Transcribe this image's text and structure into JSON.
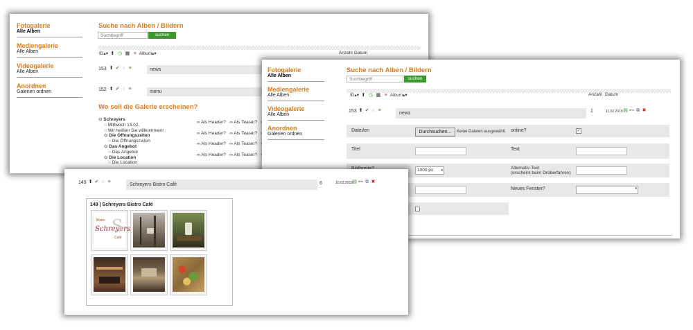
{
  "sidebar_top": {
    "items": [
      {
        "head": "Fotogalerie",
        "sub": "Alle Alben"
      },
      {
        "head": "Mediengalerie",
        "sub": "Alle Alben"
      },
      {
        "head": "Videogalerie",
        "sub": "Alle Alben"
      },
      {
        "head": "Anordnen",
        "sub": "Galerien ordnen"
      }
    ]
  },
  "sidebar_right": {
    "items": [
      {
        "head": "Fotogalerie",
        "sub": "Alle Alben"
      },
      {
        "head": "Mediengalerie",
        "sub": "Alle Alben"
      },
      {
        "head": "Videogalerie",
        "sub": "Alle Alben"
      },
      {
        "head": "Anordnen",
        "sub": "Galerien ordnen"
      }
    ]
  },
  "search": {
    "title": "Suche nach Alben / Bildern",
    "placeholder": "Suchbegriff",
    "button": "suchen"
  },
  "table": {
    "col_id": "ID",
    "col_album": "Album",
    "col_count": "Anzahl",
    "col_date": "Datum"
  },
  "back_rows": [
    {
      "id": "153",
      "name": "news"
    },
    {
      "id": "152",
      "name": "menu"
    }
  ],
  "placement": {
    "title": "Wo soll die Galerie erscheinen?",
    "tree": [
      {
        "label": "Schreyers",
        "bold": true,
        "level": 0
      },
      {
        "label": "Mittwoch 13.02.",
        "bold": false,
        "level": 1
      },
      {
        "label": "Wir heißen Sie willkommen!",
        "bold": false,
        "level": 1
      },
      {
        "label": "Die Öffnungszeiten",
        "bold": true,
        "level": 1
      },
      {
        "label": "Die Öffnungszeiten",
        "bold": false,
        "level": 2
      },
      {
        "label": "Das Angebot",
        "bold": true,
        "level": 1
      },
      {
        "label": "Das Angebot",
        "bold": false,
        "level": 2
      },
      {
        "label": "Die Location",
        "bold": true,
        "level": 1
      },
      {
        "label": "Die Location",
        "bold": false,
        "level": 2
      }
    ],
    "header_label": "Als Header?",
    "teaser_label": "Als Teaser?"
  },
  "edit_row": {
    "id": "153",
    "name": "news",
    "count": "1",
    "date": "11.02.2019"
  },
  "form": {
    "file_label": "Datei/en",
    "file_button": "Durchsuchen...",
    "file_status": "Keine Dateien ausgewählt.",
    "online_label": "online?",
    "title_label": "Titel",
    "text_label": "Text",
    "width_label": "Bildbreite?",
    "width_value": "1000 px",
    "alt_label_line1": "Alternativ-Text",
    "alt_label_line2": "(erscheint beim Drüberfahren)",
    "newwin_label": "Neues Fenster?"
  },
  "bottom_row": {
    "id": "149",
    "name": "Schreyers Bistro Café",
    "count": "6",
    "date": "10.02.2019"
  },
  "gallery": {
    "title": "149 | Schreyers Bistro Café",
    "logo_text": "Schreyers",
    "logo_small_top": "Bistro",
    "logo_small_bottom": "Café"
  },
  "colors": {
    "accent": "#e07a1a",
    "button_green": "#3a9b2c"
  }
}
